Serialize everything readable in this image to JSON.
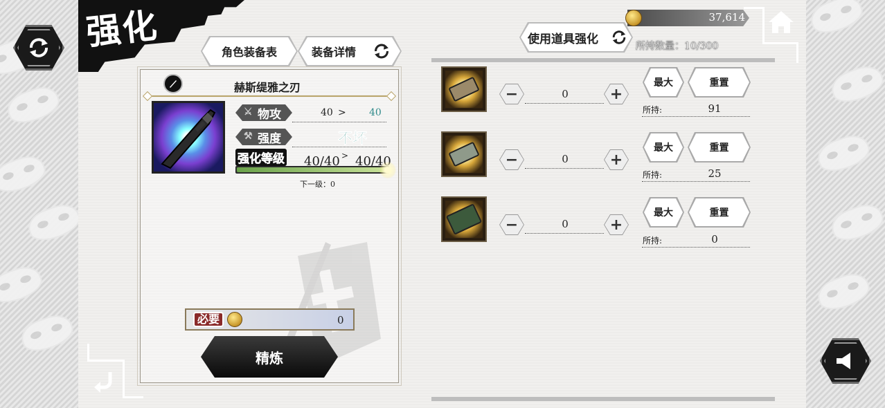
{
  "header": {
    "title": "强化",
    "tab_equipment_table": "角色装备表",
    "tab_equipment_detail": "装备详情",
    "currency_amount": "37,614"
  },
  "weapon": {
    "name": "赫斯缇雅之刃",
    "attack_label": "物攻",
    "attack_current": "40",
    "attack_arrow": ">",
    "attack_next": "40",
    "durability_label": "强度",
    "durability_value": "不坏",
    "enhance_level_label": "强化等级",
    "level_current": "40/40",
    "level_arrow": ">",
    "level_next": "40/40",
    "level_progress": 1.0,
    "next_level_text": "下一级：0"
  },
  "cost": {
    "required_label": "必要",
    "amount": "0"
  },
  "refine_button": "精炼",
  "items_panel": {
    "title": "使用道具强化",
    "held_count": "所持数量：10/300",
    "items": [
      {
        "qty": "0",
        "max_label": "最大",
        "reset_label": "重置",
        "held_label": "所持:",
        "held_value": "91",
        "stone_color": "#9b8a6a"
      },
      {
        "qty": "0",
        "max_label": "最大",
        "reset_label": "重置",
        "held_label": "所持:",
        "held_value": "25",
        "stone_color": "#8f9a8a"
      },
      {
        "qty": "0",
        "max_label": "最大",
        "reset_label": "重置",
        "held_label": "所持:",
        "held_value": "0",
        "stone_color": "#3c5a3c"
      }
    ]
  }
}
